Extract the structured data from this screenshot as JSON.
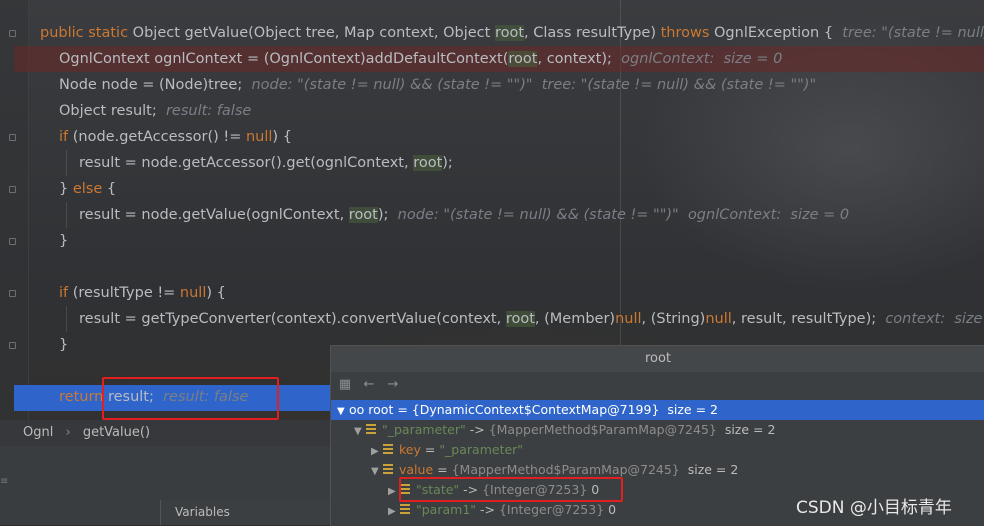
{
  "editor": {
    "lines": [
      {
        "segments": [
          {
            "t": "public static ",
            "c": "kw"
          },
          {
            "t": "Object getValue(Object tree, Map context, Object "
          },
          {
            "t": "root",
            "c": "hiword"
          },
          {
            "t": ", Class resultType) "
          },
          {
            "t": "throws ",
            "c": "kw"
          },
          {
            "t": "OgnlException {  "
          },
          {
            "t": "tree: \"(state != null) &",
            "c": "hint"
          }
        ]
      },
      {
        "segments": [
          {
            "t": "OgnlContext ognlContext = (OgnlContext)addDefaultContext("
          },
          {
            "t": "root",
            "c": "hiword"
          },
          {
            "t": ", context);  "
          },
          {
            "t": "ognlContext:  size = 0",
            "c": "hint"
          }
        ]
      },
      {
        "segments": [
          {
            "t": "Node node = (Node)tree;  "
          },
          {
            "t": "node: \"(state != null) && (state != \"\")\"  tree: \"(state != null) && (state != \"\")\"",
            "c": "hint"
          }
        ]
      },
      {
        "segments": [
          {
            "t": "Object result;  "
          },
          {
            "t": "result: false",
            "c": "hint"
          }
        ]
      },
      {
        "segments": [
          {
            "t": "if ",
            "c": "kw"
          },
          {
            "t": "(node.getAccessor() != "
          },
          {
            "t": "null",
            "c": "kw"
          },
          {
            "t": ") {"
          }
        ]
      },
      {
        "segments": [
          {
            "t": "result = node.getAccessor().get(ognlContext, "
          },
          {
            "t": "root",
            "c": "hiword"
          },
          {
            "t": ");"
          }
        ]
      },
      {
        "segments": [
          {
            "t": "} "
          },
          {
            "t": "else ",
            "c": "kw"
          },
          {
            "t": "{"
          }
        ]
      },
      {
        "segments": [
          {
            "t": "result = node.getValue(ognlContext, "
          },
          {
            "t": "root",
            "c": "hiword"
          },
          {
            "t": ");  "
          },
          {
            "t": "node: \"(state != null) && (state != \"\")\"  ognlContext:  size = 0",
            "c": "hint"
          }
        ]
      },
      {
        "segments": [
          {
            "t": "}"
          }
        ]
      },
      {
        "segments": []
      },
      {
        "segments": [
          {
            "t": "if ",
            "c": "kw"
          },
          {
            "t": "(resultType != "
          },
          {
            "t": "null",
            "c": "kw"
          },
          {
            "t": ") {"
          }
        ]
      },
      {
        "segments": [
          {
            "t": "result = getTypeConverter(context).convertValue(context, "
          },
          {
            "t": "root",
            "c": "hiword"
          },
          {
            "t": ", (Member)"
          },
          {
            "t": "null",
            "c": "kw"
          },
          {
            "t": ", (String)"
          },
          {
            "t": "null",
            "c": "kw"
          },
          {
            "t": ", result, resultType);  "
          },
          {
            "t": "context:  size =",
            "c": "hint"
          }
        ]
      },
      {
        "segments": [
          {
            "t": "}"
          }
        ]
      },
      {
        "segments": []
      },
      {
        "segments": [
          {
            "t": "return ",
            "c": "kw"
          },
          {
            "t": "result;  "
          },
          {
            "t": "result: false",
            "c": "hint"
          }
        ]
      }
    ]
  },
  "breadcrumb": {
    "class_name": "Ognl",
    "separator": "›",
    "method_name": "getValue()"
  },
  "variables_tab": {
    "label": "Variables"
  },
  "popup": {
    "title": "root",
    "toolbar": {
      "pin_icon": "pin-icon",
      "back_icon": "arrow-left-icon",
      "forward_icon": "arrow-right-icon"
    },
    "rows": [
      {
        "name": "root",
        "eq": " = ",
        "value": "{DynamicContext$ContextMap@7199}",
        "extra": "  size = 2",
        "icon": "glasses-icon",
        "expanded": true,
        "level": 0,
        "selected": true
      },
      {
        "name": "\"_parameter\"",
        "eq": " -> ",
        "value": "{MapperMethod$ParamMap@7245}",
        "extra": "  size = 2",
        "icon": "field-icon",
        "expanded": true,
        "level": 1,
        "selected": false
      },
      {
        "name": "key",
        "eq": " = ",
        "value": "\"_parameter\"",
        "extra": "",
        "icon": "field-icon",
        "expanded": false,
        "level": 2,
        "selected": false
      },
      {
        "name": "value",
        "eq": " = ",
        "value": "{MapperMethod$ParamMap@7245}",
        "extra": "  size = 2",
        "icon": "field-icon",
        "expanded": true,
        "level": 2,
        "selected": false
      },
      {
        "name": "\"state\"",
        "eq": " -> ",
        "value": "{Integer@7253}",
        "extra": " 0",
        "icon": "field-icon",
        "expanded": false,
        "level": 3,
        "selected": false
      },
      {
        "name": "\"param1\"",
        "eq": " -> ",
        "value": "{Integer@7253}",
        "extra": " 0",
        "icon": "field-icon",
        "expanded": false,
        "level": 3,
        "selected": false
      }
    ]
  },
  "watermark": "CSDN @小目标青年"
}
